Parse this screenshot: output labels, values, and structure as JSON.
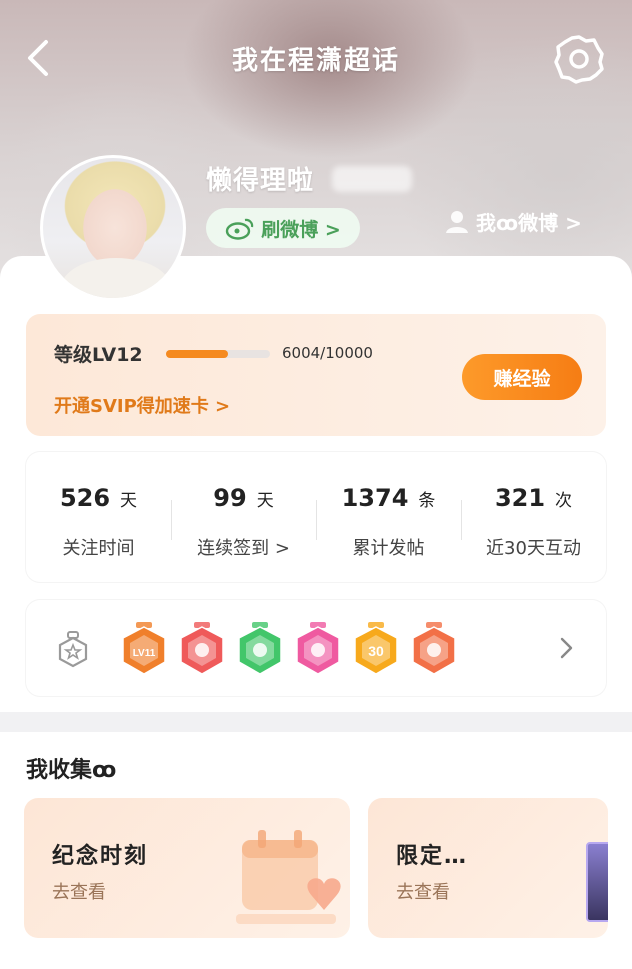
{
  "header": {
    "title": "我在程潇超话",
    "username": "懒得理啦",
    "weibo_button": "刷微博 >",
    "my_weibo_link": "我ꝏ微博 >"
  },
  "level": {
    "label": "等级LV12",
    "progress_text": "6004/10000",
    "progress_fraction": 0.6,
    "svip_link": "开通SVIP得加速卡 >",
    "earn_button": "赚经验"
  },
  "stats": [
    {
      "value": "526",
      "unit": "天",
      "label": "关注时间"
    },
    {
      "value": "99",
      "unit": "天",
      "label": "连续签到 >"
    },
    {
      "value": "1374",
      "unit": "条",
      "label": "累计发帖"
    },
    {
      "value": "321",
      "unit": "次",
      "label": "近30天互动"
    }
  ],
  "badges": {
    "medal_icon": "medal-outline-icon",
    "items": [
      {
        "icon": "lv11-badge",
        "color": "#f07f2b",
        "text": "LV11"
      },
      {
        "icon": "trophy-badge",
        "color": "#ef5a5a",
        "text": ""
      },
      {
        "icon": "hand-badge",
        "color": "#42c66a",
        "text": ""
      },
      {
        "icon": "gradcap-badge",
        "color": "#ef5aa0",
        "text": ""
      },
      {
        "icon": "days-30-badge",
        "color": "#f7a91c",
        "text": "30"
      },
      {
        "icon": "rock-hand-badge",
        "color": "#f27047",
        "text": ""
      }
    ]
  },
  "collection": {
    "title": "我收集ꝏ",
    "cards": [
      {
        "title": "纪念时刻",
        "subtitle": "去查看"
      },
      {
        "title": "限定…",
        "subtitle": "去查看"
      }
    ]
  },
  "colors": {
    "accent": "#f58a1f",
    "weibo_green": "#4aa05a"
  }
}
